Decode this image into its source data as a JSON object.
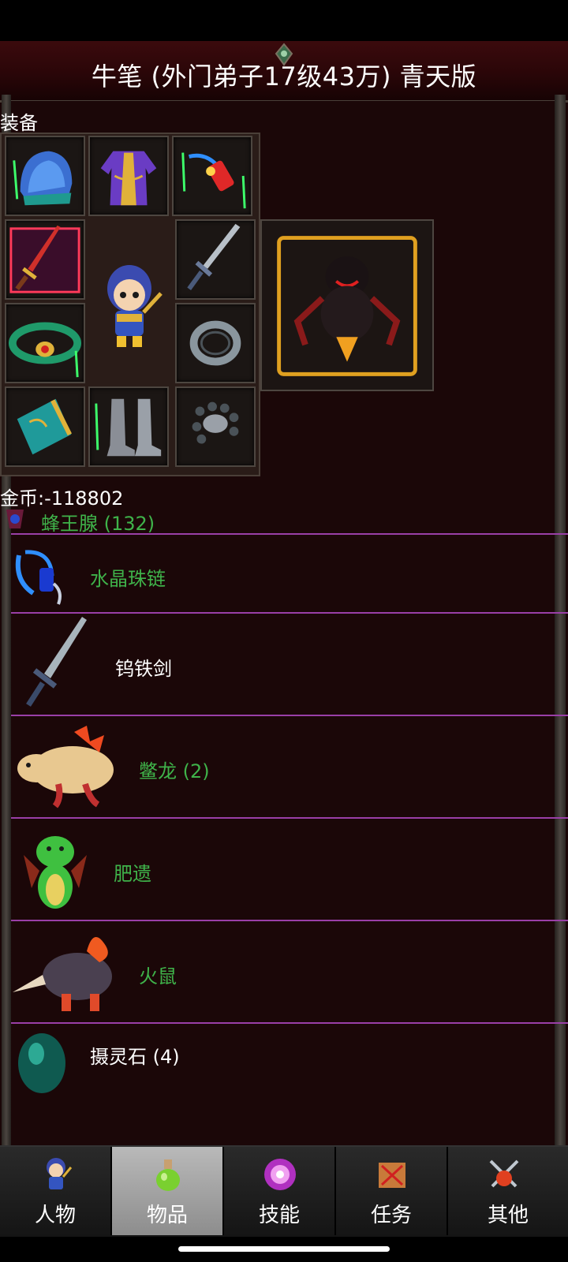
{
  "header": {
    "title": "牛笔 (外门弟子17级43万) 青天版"
  },
  "equipment": {
    "section_label": "装备",
    "slots": [
      {
        "id": "helmet",
        "icon": "helmet-icon"
      },
      {
        "id": "armor",
        "icon": "robe-icon"
      },
      {
        "id": "necklace",
        "icon": "necklace-icon"
      },
      {
        "id": "weapon-left",
        "icon": "red-sword-icon"
      },
      {
        "id": "weapon-right",
        "icon": "sword-icon"
      },
      {
        "id": "belt",
        "icon": "belt-icon"
      },
      {
        "id": "ring",
        "icon": "ring-icon"
      },
      {
        "id": "bracer",
        "icon": "bracer-icon"
      },
      {
        "id": "boots",
        "icon": "boots-icon"
      },
      {
        "id": "bracelet",
        "icon": "bead-bracelet-icon"
      },
      {
        "id": "mount",
        "icon": "dark-beast-icon"
      }
    ]
  },
  "gold": {
    "text": "金币:-118802"
  },
  "inventory": {
    "items": [
      {
        "name": "蜂王腺 (132)",
        "icon": "bee-gland-icon",
        "color": "#3fb34a"
      },
      {
        "name": "水晶珠链",
        "icon": "crystal-chain-icon",
        "color": "#3fb34a"
      },
      {
        "name": "钨铁剑",
        "icon": "iron-sword-icon",
        "color": "#ffffff"
      },
      {
        "name": "鳖龙 (2)",
        "icon": "turtle-dragon-icon",
        "color": "#3fb34a"
      },
      {
        "name": "肥遗",
        "icon": "green-dragon-icon",
        "color": "#3fb34a"
      },
      {
        "name": "火鼠",
        "icon": "fire-rat-icon",
        "color": "#3fb34a"
      },
      {
        "name": "摄灵石 (4)",
        "icon": "spirit-stone-icon",
        "color": "#ffffff"
      }
    ]
  },
  "tabs": [
    {
      "label": "人物",
      "icon": "character-icon",
      "active": false
    },
    {
      "label": "物品",
      "icon": "potion-icon",
      "active": true
    },
    {
      "label": "技能",
      "icon": "skill-orb-icon",
      "active": false
    },
    {
      "label": "任务",
      "icon": "quest-icon",
      "active": false
    },
    {
      "label": "其他",
      "icon": "swords-icon",
      "active": false
    }
  ]
}
